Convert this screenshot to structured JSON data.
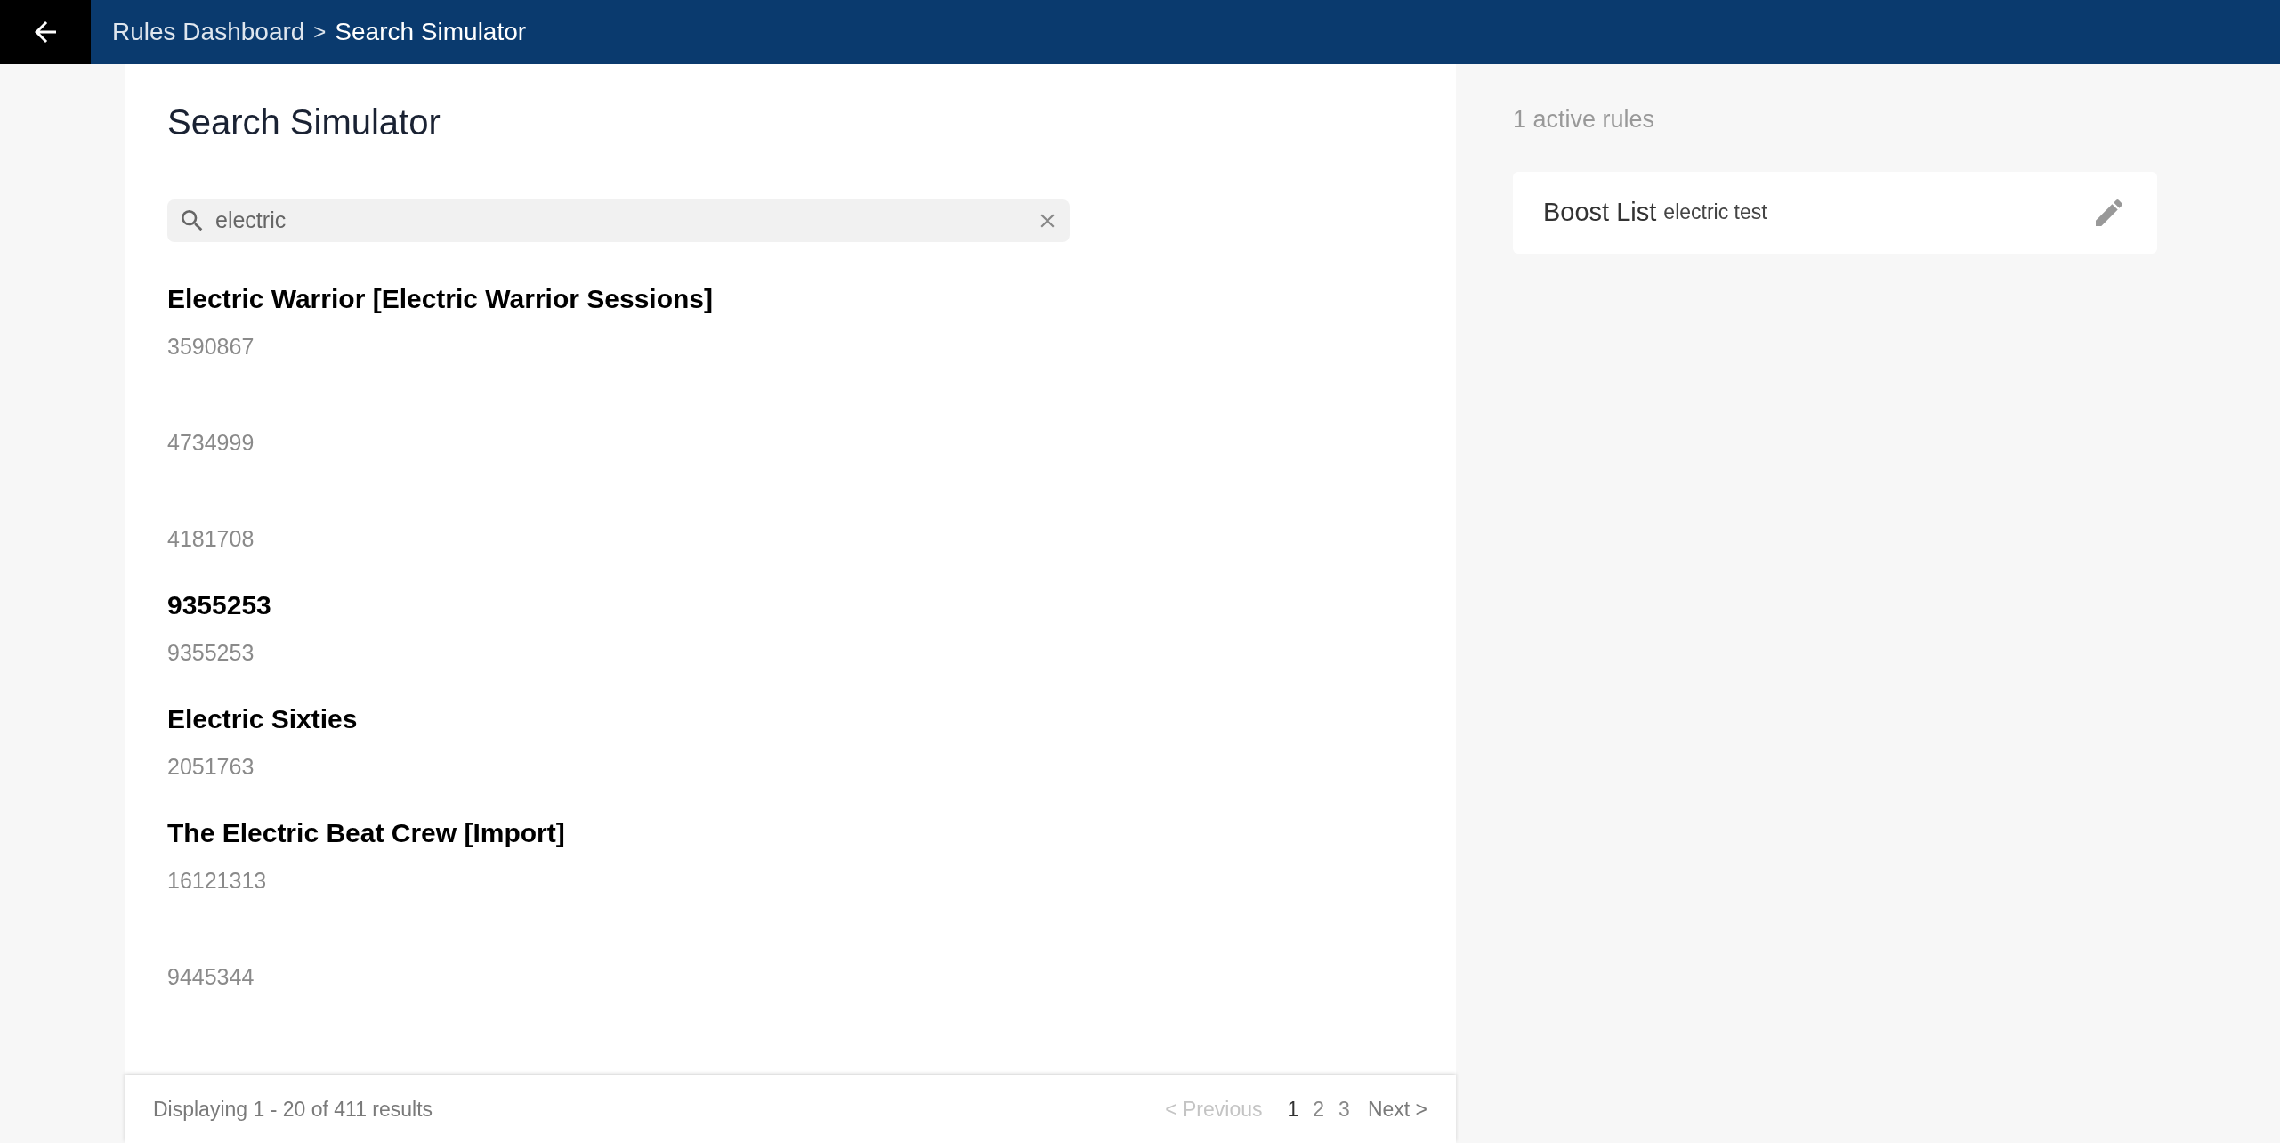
{
  "header": {
    "breadcrumb_parent": "Rules Dashboard",
    "separator": ">",
    "breadcrumb_current": "Search Simulator"
  },
  "page_title": "Search Simulator",
  "search": {
    "value": "electric"
  },
  "results": [
    {
      "title": "Electric Warrior [Electric Warrior Sessions]",
      "id": "3590867"
    },
    {
      "id": "4734999"
    },
    {
      "id": "4181708"
    },
    {
      "title": "9355253",
      "id": "9355253"
    },
    {
      "title": "Electric Sixties",
      "id": "2051763"
    },
    {
      "title": "The Electric Beat Crew [Import]",
      "id": "16121313"
    },
    {
      "id": "9445344"
    }
  ],
  "footer": {
    "summary": "Displaying 1 - 20 of 411 results",
    "previous": {
      "label": "< Previous",
      "disabled": true
    },
    "pages": [
      {
        "label": "1",
        "selected": true
      },
      {
        "label": "2",
        "selected": false
      },
      {
        "label": "3",
        "selected": false
      }
    ],
    "next": {
      "label": "Next >",
      "disabled": false
    }
  },
  "rules_panel": {
    "count": "1 active rules",
    "rules": [
      {
        "type": "Boost List",
        "name": "electric test"
      }
    ]
  }
}
